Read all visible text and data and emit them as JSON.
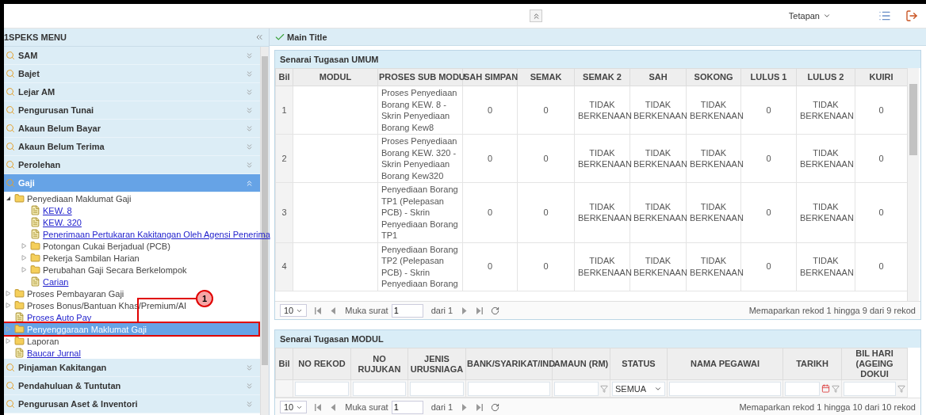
{
  "top_bar": {
    "settings_menu": "Tetapan"
  },
  "sidebar": {
    "title": "1SPEKS MENU",
    "sections": [
      {
        "label": "SAM",
        "selected": false,
        "expanded": false
      },
      {
        "label": "Bajet",
        "selected": false,
        "expanded": false
      },
      {
        "label": "Lejar AM",
        "selected": false,
        "expanded": false
      },
      {
        "label": "Pengurusan Tunai",
        "selected": false,
        "expanded": false
      },
      {
        "label": "Akaun Belum Bayar",
        "selected": false,
        "expanded": false
      },
      {
        "label": "Akaun Belum Terima",
        "selected": false,
        "expanded": false
      },
      {
        "label": "Perolehan",
        "selected": false,
        "expanded": false
      },
      {
        "label": "Gaji",
        "selected": true,
        "expanded": true,
        "children": [
          {
            "label": "Penyediaan Maklumat Gaji",
            "kind": "folder",
            "expanded": true,
            "selected": false,
            "children": [
              {
                "label": "KEW. 8",
                "kind": "link",
                "selected": false
              },
              {
                "label": "KEW. 320",
                "kind": "link",
                "selected": false
              },
              {
                "label": "Penerimaan Pertukaran Kakitangan Oleh Agensi Penerima",
                "kind": "link",
                "selected": false
              },
              {
                "label": "Potongan Cukai Berjadual (PCB)",
                "kind": "folder",
                "expanded": false,
                "selected": false
              },
              {
                "label": "Pekerja Sambilan Harian",
                "kind": "folder",
                "expanded": false,
                "selected": false
              },
              {
                "label": "Perubahan Gaji Secara Berkelompok",
                "kind": "folder",
                "expanded": false,
                "selected": false
              },
              {
                "label": "Carian",
                "kind": "link",
                "selected": false
              }
            ]
          },
          {
            "label": "Proses Pembayaran Gaji",
            "kind": "folder",
            "expanded": false,
            "selected": false
          },
          {
            "label": "Proses Bonus/Bantuan Khas/Premium/AI",
            "kind": "folder",
            "expanded": false,
            "selected": false
          },
          {
            "label": "Proses Auto Pay",
            "kind": "link",
            "selected": false
          },
          {
            "label": "Penyenggaraan Maklumat Gaji",
            "kind": "folder",
            "expanded": false,
            "selected": true
          },
          {
            "label": "Laporan",
            "kind": "folder",
            "expanded": false,
            "selected": false
          },
          {
            "label": "Baucar Jurnal",
            "kind": "link",
            "selected": false
          }
        ]
      },
      {
        "label": "Pinjaman Kakitangan",
        "selected": false,
        "expanded": false
      },
      {
        "label": "Pendahuluan & Tuntutan",
        "selected": false,
        "expanded": false
      },
      {
        "label": "Pengurusan Aset & Inventori",
        "selected": false,
        "expanded": false
      }
    ]
  },
  "annotation": {
    "label": "1"
  },
  "main_title": "Main Title",
  "umum_panel": {
    "title": "Senarai Tugasan UMUM",
    "columns": [
      "Bil",
      "MODUL",
      "PROSES SUB MODU",
      "SAH SIMPAN",
      "SEMAK",
      "SEMAK 2",
      "SAH",
      "SOKONG",
      "LULUS 1",
      "LULUS 2",
      "KUIRI"
    ],
    "rows": [
      {
        "number": "1",
        "process": "Proses Penyediaan Borang KEW. 8 - Skrin Penyediaan Borang Kew8",
        "values": [
          "0",
          "0",
          "TIDAK BERKENAAN",
          "TIDAK BERKENAAN",
          "TIDAK BERKENAAN",
          "0",
          "TIDAK BERKENAAN",
          "0"
        ]
      },
      {
        "number": "2",
        "process": "Proses Penyediaan Borang KEW. 320 - Skrin Penyediaan Borang Kew320",
        "values": [
          "0",
          "0",
          "TIDAK BERKENAAN",
          "TIDAK BERKENAAN",
          "TIDAK BERKENAAN",
          "0",
          "TIDAK BERKENAAN",
          "0"
        ]
      },
      {
        "number": "3",
        "process": "Penyediaan Borang TP1 (Pelepasan PCB) - Skrin Penyediaan Borang TP1",
        "values": [
          "0",
          "0",
          "TIDAK BERKENAAN",
          "TIDAK BERKENAAN",
          "TIDAK BERKENAAN",
          "0",
          "TIDAK BERKENAAN",
          "0"
        ]
      },
      {
        "number": "4",
        "process": "Penyediaan Borang TP2 (Pelepasan PCB) - Skrin Penyediaan Borang",
        "values": [
          "0",
          "0",
          "TIDAK BERKENAAN",
          "TIDAK BERKENAAN",
          "TIDAK BERKENAAN",
          "0",
          "TIDAK BERKENAAN",
          "0"
        ]
      }
    ],
    "pager": {
      "page_size": "10",
      "page_label": "Muka surat",
      "page": "1",
      "of_label": "dari 1",
      "summary": "Memaparkan rekod 1 hingga 9 dari 9 rekod"
    }
  },
  "modul_panel": {
    "title": "Senarai Tugasan MODUL",
    "columns": [
      {
        "label": "Bil",
        "kind": "plain"
      },
      {
        "label": "NO REKOD",
        "kind": "text"
      },
      {
        "label": "NO RUJUKAN",
        "kind": "text"
      },
      {
        "label": "JENIS URUSNIAGA",
        "kind": "text"
      },
      {
        "label": "BANK/SYARIKAT/IND",
        "kind": "text"
      },
      {
        "label": "AMAUN (RM)",
        "kind": "funnel"
      },
      {
        "label": "STATUS",
        "kind": "select",
        "filter_value": "SEMUA"
      },
      {
        "label": "NAMA PEGAWAI",
        "kind": "text"
      },
      {
        "label": "TARIKH",
        "kind": "date"
      },
      {
        "label": "BIL HARI (AGEING DOKUI",
        "kind": "funnel"
      }
    ],
    "pager": {
      "page_size": "10",
      "page_label": "Muka surat",
      "page": "1",
      "of_label": "dari 1",
      "summary": "Memaparkan rekod 1 hingga 10 dari 10 rekod"
    }
  }
}
